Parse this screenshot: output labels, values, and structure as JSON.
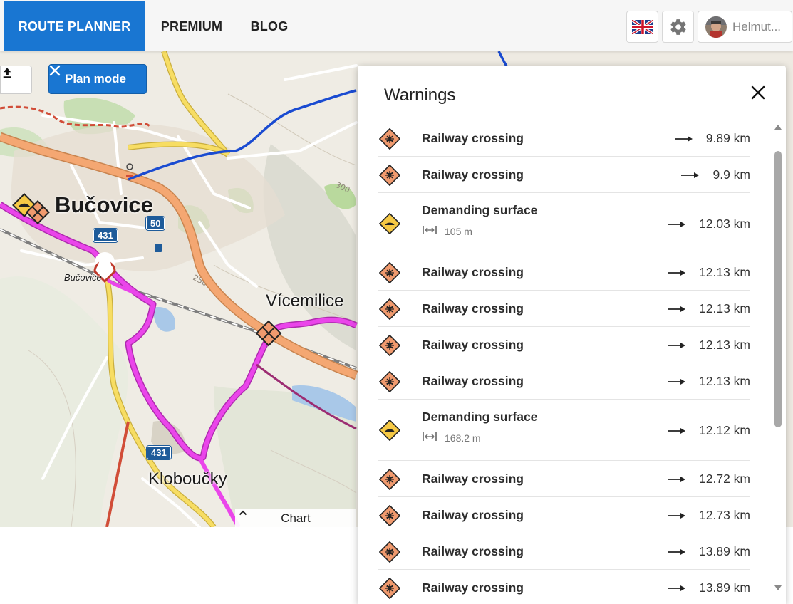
{
  "nav": {
    "tabs": [
      {
        "label": "ROUTE PLANNER",
        "active": true
      },
      {
        "label": "PREMIUM",
        "active": false
      },
      {
        "label": "BLOG",
        "active": false
      }
    ],
    "language_icon": "uk-flag-icon",
    "settings_icon": "gear-icon",
    "user_name": "Helmut..."
  },
  "map": {
    "plan_mode_label": "Plan mode",
    "chart_toggle_label": "Chart",
    "labels": {
      "town_main": "Bučovice",
      "town_east": "Vícemilice",
      "town_south": "Kloboučky",
      "station": "Bučovice"
    },
    "road_shields": [
      "431",
      "50",
      "431"
    ],
    "contour_labels": [
      "300",
      "250"
    ],
    "colors": {
      "route": "#e040e0",
      "road_main": "#f2a36a",
      "road_secondary": "#f6dc62",
      "trail_red": "#d94a3a",
      "trail_blue": "#1a4bd1",
      "accent": "#1976d2"
    }
  },
  "warnings": {
    "title": "Warnings",
    "items": [
      {
        "type": "railway",
        "label": "Railway crossing",
        "distance": "9.89 km"
      },
      {
        "type": "railway",
        "label": "Railway crossing",
        "distance": "9.9 km"
      },
      {
        "type": "surface",
        "label": "Demanding surface",
        "length": "105 m",
        "distance": "12.03 km"
      },
      {
        "type": "railway",
        "label": "Railway crossing",
        "distance": "12.13 km"
      },
      {
        "type": "railway",
        "label": "Railway crossing",
        "distance": "12.13 km"
      },
      {
        "type": "railway",
        "label": "Railway crossing",
        "distance": "12.13 km"
      },
      {
        "type": "railway",
        "label": "Railway crossing",
        "distance": "12.13 km"
      },
      {
        "type": "surface",
        "label": "Demanding surface",
        "length": "168.2 m",
        "distance": "12.12 km"
      },
      {
        "type": "railway",
        "label": "Railway crossing",
        "distance": "12.72 km"
      },
      {
        "type": "railway",
        "label": "Railway crossing",
        "distance": "12.73 km"
      },
      {
        "type": "railway",
        "label": "Railway crossing",
        "distance": "13.89 km"
      },
      {
        "type": "railway",
        "label": "Railway crossing",
        "distance": "13.89 km"
      }
    ]
  }
}
